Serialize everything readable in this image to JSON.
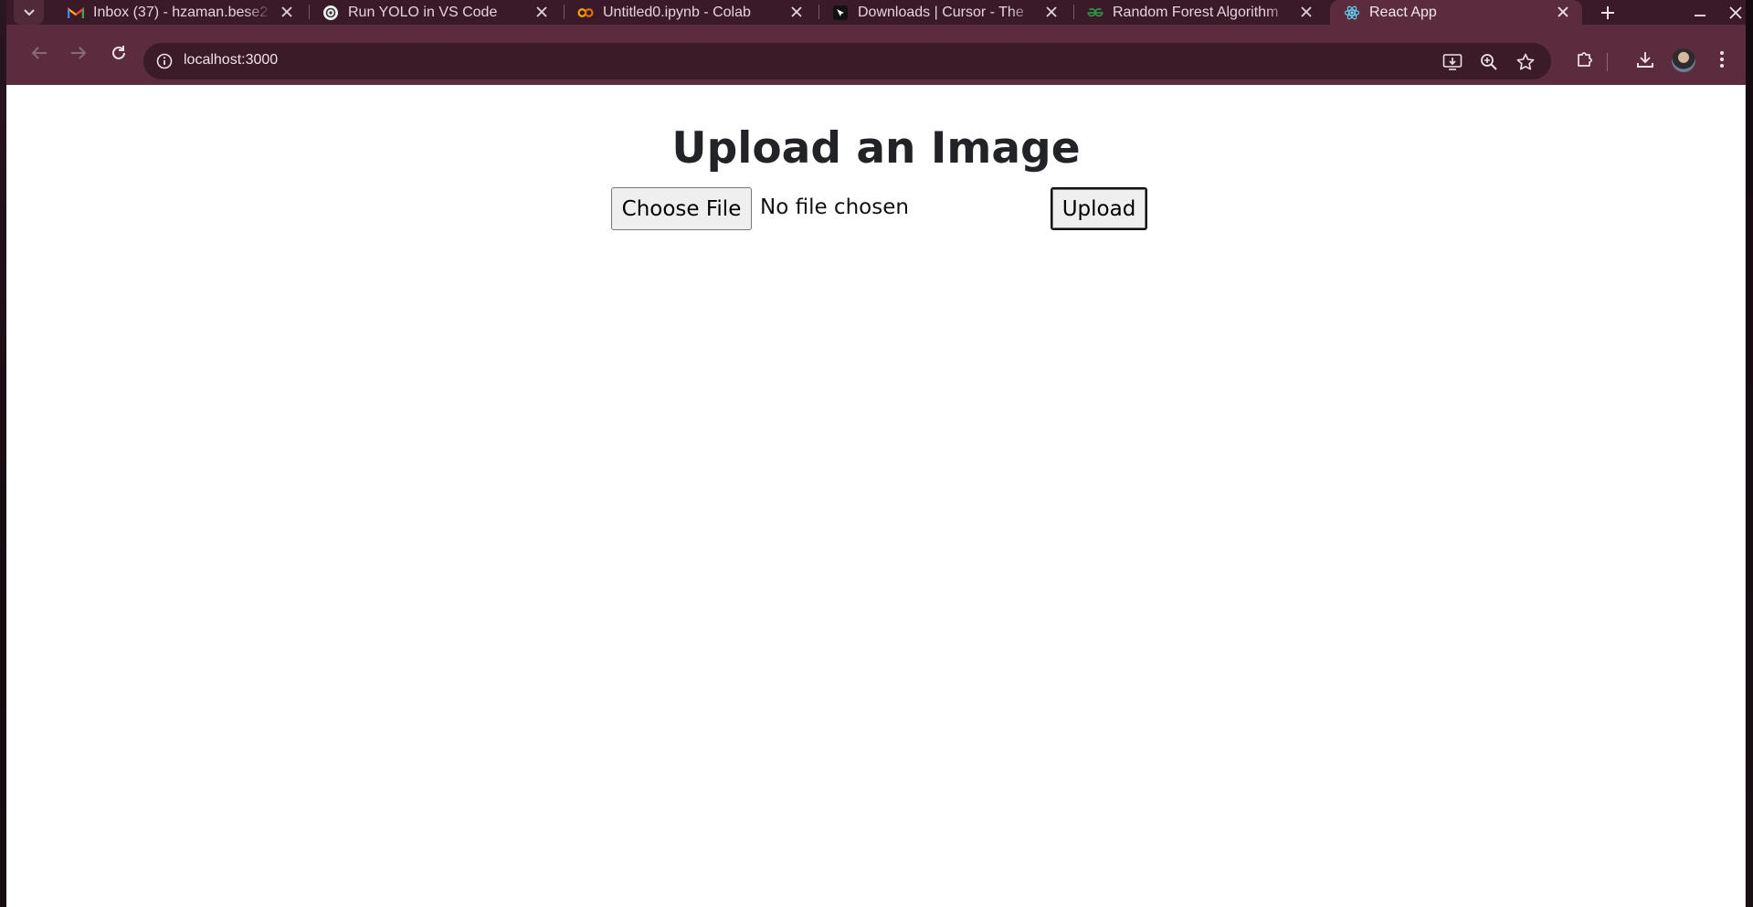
{
  "browser": {
    "tabs": [
      {
        "title": "Inbox (37) - hzaman.bese2",
        "icon": "gmail-icon",
        "active": false
      },
      {
        "title": "Run YOLO in VS Code",
        "icon": "openai-icon",
        "active": false
      },
      {
        "title": "Untitled0.ipynb - Colab",
        "icon": "colab-icon",
        "active": false
      },
      {
        "title": "Downloads | Cursor - The",
        "icon": "cursor-icon",
        "active": false
      },
      {
        "title": "Random Forest Algorithm",
        "icon": "geeksforgeeks-icon",
        "active": false
      },
      {
        "title": "React App",
        "icon": "react-icon",
        "active": true
      }
    ],
    "address": "localhost:3000",
    "colors": {
      "frame": "#3a1a28",
      "toolbar": "#5b2b3e",
      "omnibox": "#3b1b28"
    }
  },
  "page": {
    "heading": "Upload an Image",
    "file_input": {
      "button_label": "Choose File",
      "status_text": "No file chosen"
    },
    "upload_label": "Upload"
  }
}
